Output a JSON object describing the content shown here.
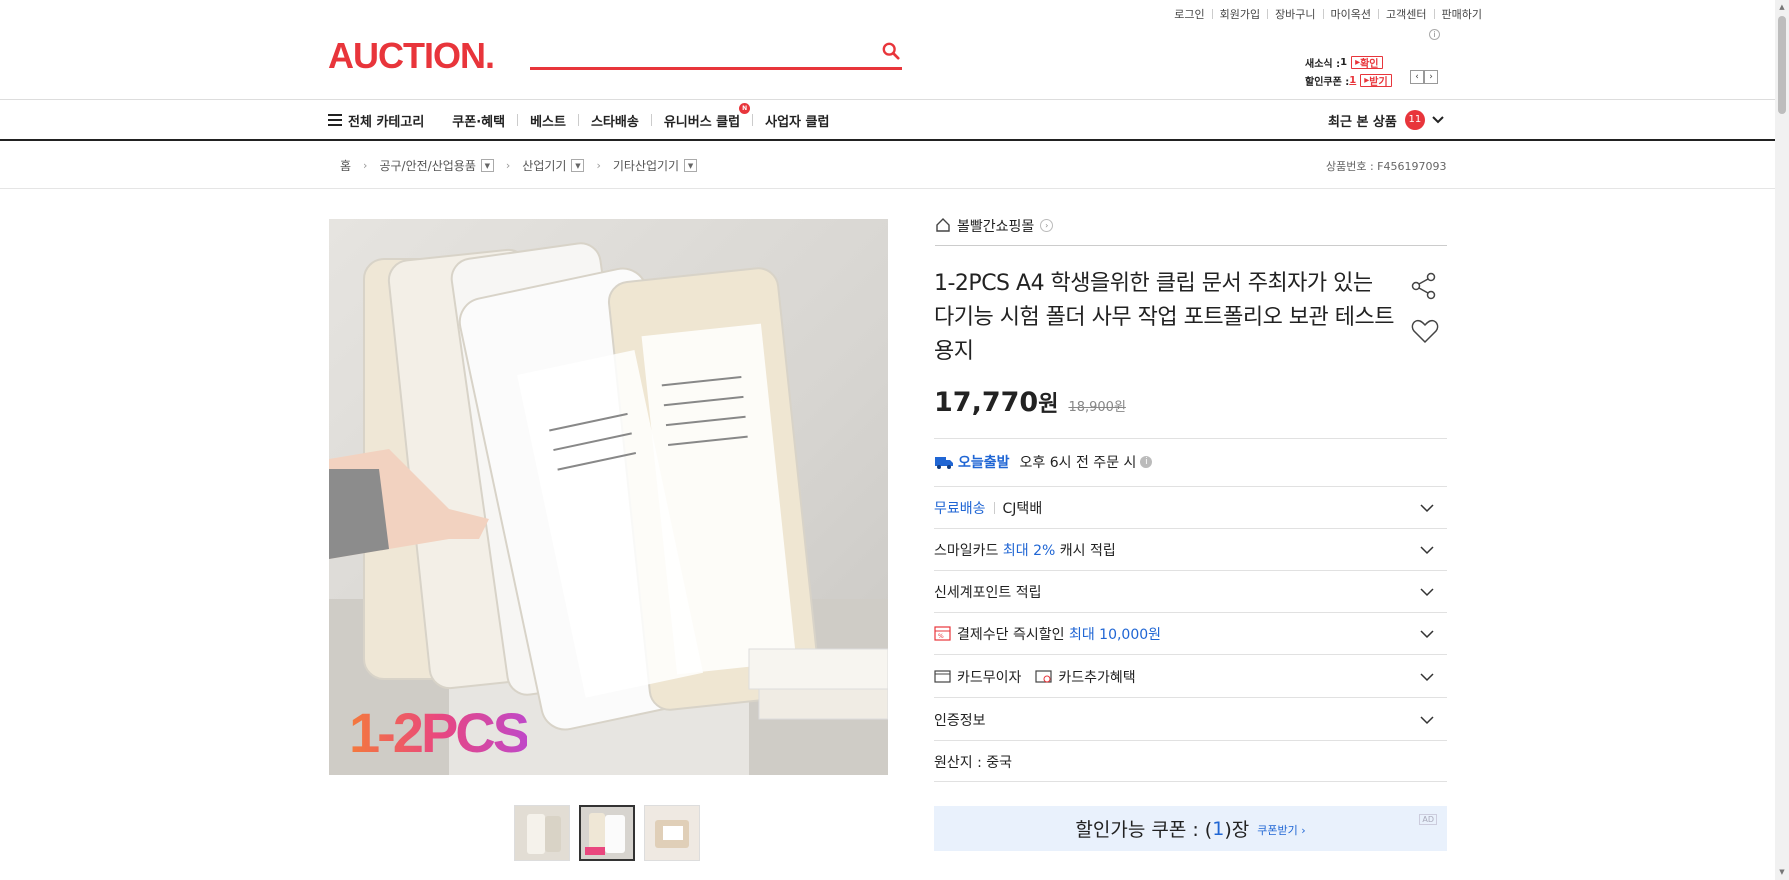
{
  "util_links": [
    "로그인",
    "회원가입",
    "장바구니",
    "마이옥션",
    "고객센터",
    "판매하기"
  ],
  "logo": "AUCTION.",
  "search": {
    "value": "",
    "placeholder": ""
  },
  "mini": {
    "news_label": "새소식 :",
    "news_count": "1",
    "news_btn": "확인",
    "coupon_label": "할인쿠폰 :",
    "coupon_count": "1",
    "coupon_btn": "받기"
  },
  "nav": {
    "all_category": "전체 카테고리",
    "items": [
      "쿠폰·혜택",
      "베스트",
      "스타배송",
      "유니버스 클럽",
      "사업자 클럽"
    ],
    "universe_badge": "N",
    "recent_label": "최근 본 상품",
    "recent_count": "11"
  },
  "breadcrumb": [
    "홈",
    "공구/안전/산업용품",
    "산업기기",
    "기타산업기기"
  ],
  "product_no": "상품번호 : F456197093",
  "image_overlay_text": "1-2PCS",
  "store_name": "볼빨간쇼핑몰",
  "title": "1-2PCS A4 학생을위한 클립 문서 주최자가 있는 다기능 시험 폴더 사무 작업 포트폴리오 보관 테스트 용지",
  "price": {
    "sale": "17,770",
    "unit": "원",
    "original": "18,900원"
  },
  "today_ship": {
    "label": "오늘출발",
    "desc": "오후 6시 전 주문 시"
  },
  "rows": {
    "shipping": {
      "free": "무료배송",
      "courier": "CJ택배"
    },
    "smile": {
      "a": "스마일카드",
      "b": "최대 2%",
      "c": "캐시 적립"
    },
    "ssg": "신세계포인트 적립",
    "payment": {
      "a": "결제수단 즉시할인",
      "b": "최대 10,000원"
    },
    "card": {
      "a": "카드무이자",
      "b": "카드추가혜택"
    },
    "cert": "인증정보"
  },
  "origin": "원산지 : 중국",
  "coupon": {
    "pre": "할인가능 쿠폰 : (",
    "num": "1",
    "post": ")장",
    "recv": "쿠폰받기 ›",
    "ad": "AD"
  },
  "colors": {
    "brand": "#e8353b",
    "blue": "#2066d4"
  }
}
